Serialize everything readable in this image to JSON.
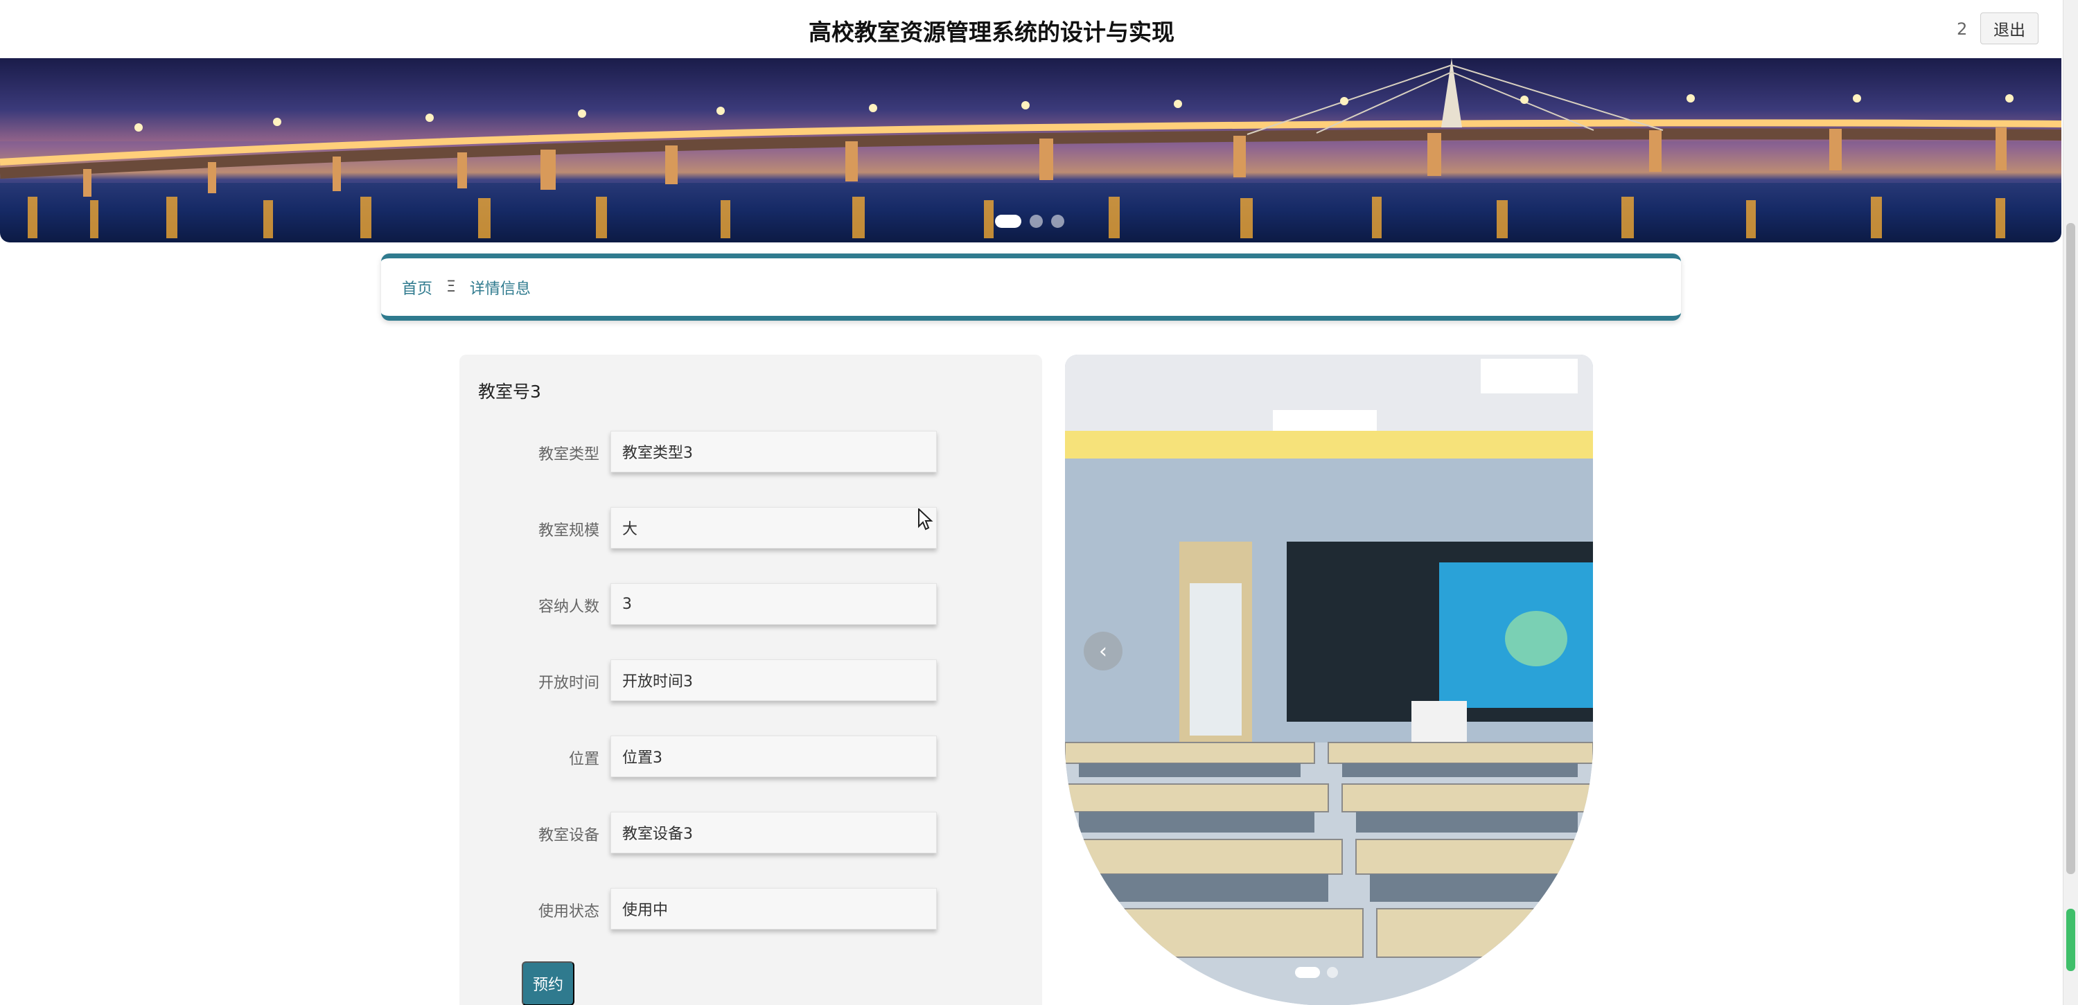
{
  "header": {
    "title": "高校教室资源管理系统的设计与实现",
    "user": "2",
    "logout_label": "退出"
  },
  "banner": {
    "slides": 3,
    "active_slide": 1
  },
  "breadcrumb": {
    "home": "首页",
    "separator": "Ξ",
    "current": "详情信息"
  },
  "detail": {
    "title": "教室号3",
    "fields": [
      {
        "label": "教室类型",
        "value": "教室类型3"
      },
      {
        "label": "教室规模",
        "value": "大"
      },
      {
        "label": "容纳人数",
        "value": "3"
      },
      {
        "label": "开放时间",
        "value": "开放时间3"
      },
      {
        "label": "位置",
        "value": "位置3"
      },
      {
        "label": "教室设备",
        "value": "教室设备3"
      },
      {
        "label": "使用状态",
        "value": "使用中"
      }
    ],
    "book_label": "预约"
  },
  "gallery": {
    "prev_icon": "‹",
    "slides": 2,
    "active_slide": 1
  },
  "colors": {
    "accent": "#2f7a8e",
    "panel_bg": "#f3f3f3",
    "input_bg": "#f7f7f7"
  }
}
